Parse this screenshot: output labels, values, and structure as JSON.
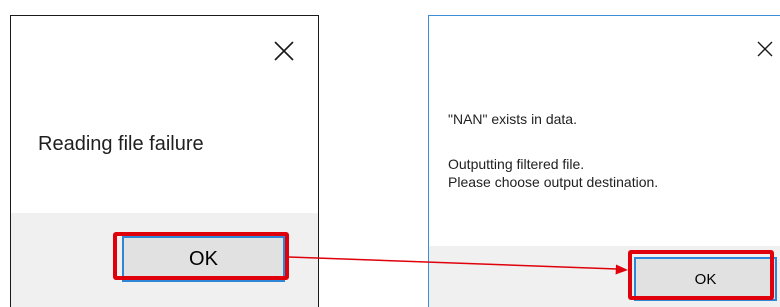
{
  "dialog_left": {
    "message": "Reading file failure",
    "ok_label": "OK"
  },
  "dialog_right": {
    "line1": "\"NAN\" exists in data.",
    "line2": "Outputting filtered file.",
    "line3": "Please choose output destination.",
    "ok_label": "OK"
  },
  "annotation": {
    "highlight_color": "#e0000b",
    "button_focus_color": "#2f86d6",
    "dialog_border_color": "#3c8ed8"
  }
}
